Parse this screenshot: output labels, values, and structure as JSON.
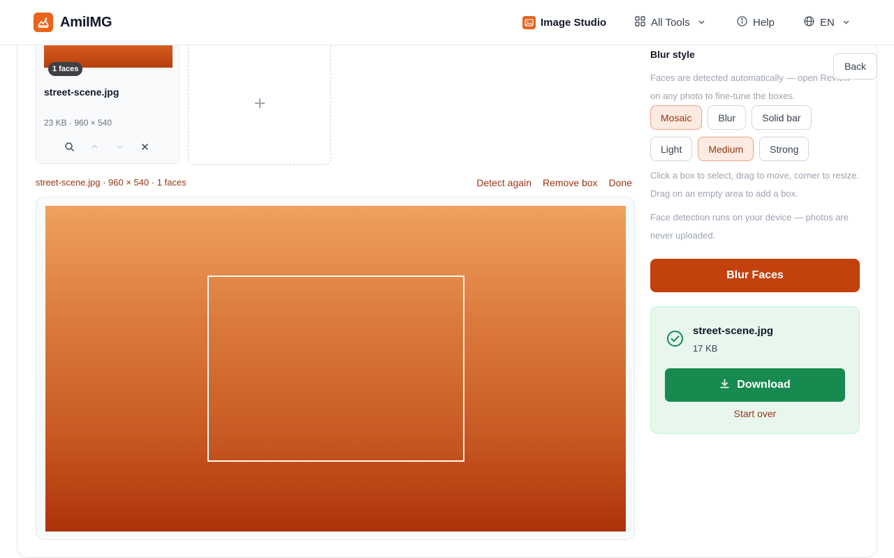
{
  "header": {
    "brand": "AmiIMG",
    "nav": {
      "studio": "Image Studio",
      "tools": "All Tools",
      "help": "Help",
      "lang": "EN"
    }
  },
  "thumbnail": {
    "faces_badge": "1 faces",
    "name": "street-scene.jpg",
    "meta": "23 KB · 960 × 540"
  },
  "editor": {
    "info": "street-scene.jpg · 960 × 540 · 1 faces",
    "actions": {
      "detect_again": "Detect again",
      "remove_box": "Remove box",
      "done": "Done"
    }
  },
  "panel": {
    "title": "Blur style",
    "hint_detect": "Faces are detected automatically — open Review on any photo to fine-tune the boxes.",
    "styles": [
      "Mosaic",
      "Blur",
      "Solid bar"
    ],
    "selected_style": "Mosaic",
    "strengths": [
      "Light",
      "Medium",
      "Strong"
    ],
    "selected_strength": "Medium",
    "hint_edit": "Click a box to select, drag to move, corner to resize. Drag on an empty area to add a box.",
    "hint_privacy": "Face detection runs on your device — photos are never uploaded.",
    "back": "Back",
    "primary": "Blur Faces"
  },
  "result": {
    "name": "street-scene.jpg",
    "size": "17 KB",
    "download": "Download",
    "start_over": "Start over"
  },
  "colors": {
    "accent": "#c2410c",
    "brand": "#e8631c",
    "success": "#168a4f"
  }
}
